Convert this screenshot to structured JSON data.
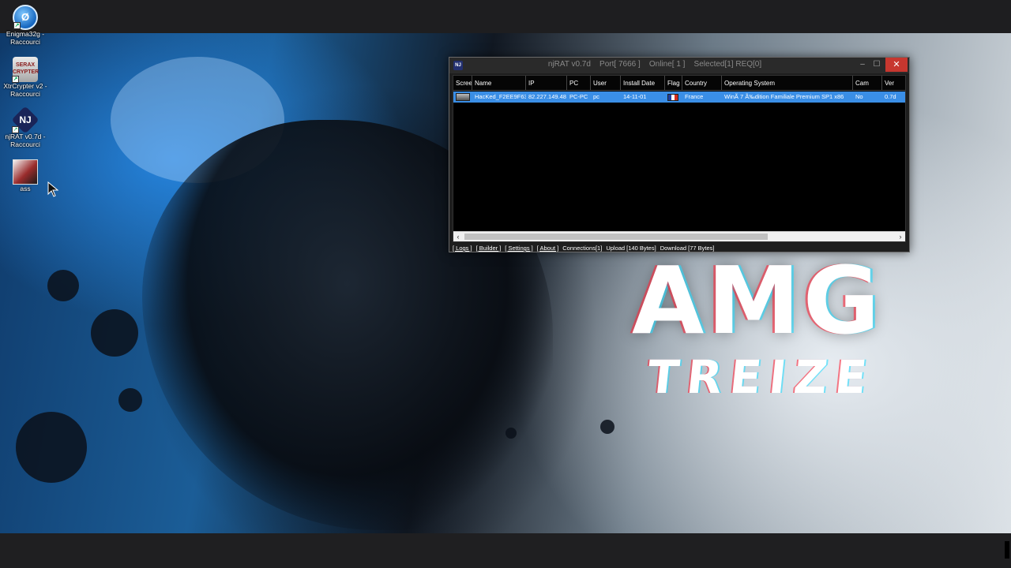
{
  "desktop": {
    "icons": [
      {
        "label": "Enigma32g - Raccourci",
        "glyph": "Ø",
        "icon": "enigma-icon"
      },
      {
        "label": "XtrCrypter v2 - Raccourci",
        "glyph": "SERAX CRYPTER",
        "icon": "serax-crypter-icon"
      },
      {
        "label": "njRAT v0.7d - Raccourci",
        "glyph": "NJ",
        "icon": "njrat-icon"
      },
      {
        "label": "ass",
        "glyph": "",
        "icon": "image-file-icon"
      }
    ]
  },
  "wallpaper": {
    "headline": "AMG",
    "subline": "TREIZE"
  },
  "window": {
    "title": "njRAT v0.7d    Port[ 7666 ]    Online[ 1 ]    Selected[1] REQ[0]",
    "app_icon_text": "NJ",
    "buttons": {
      "minimize": "–",
      "maximize": "☐",
      "close": "✕"
    },
    "columns": [
      "Scree",
      "Name",
      "IP",
      "PC",
      "User",
      "Install Date",
      "Flag",
      "Country",
      "Operating System",
      "Cam",
      "Ver"
    ],
    "rows": [
      {
        "name": "HacKed_F2EE9F63",
        "ip": "82.227.149.48",
        "pc": "PC-PC",
        "user": "pc",
        "install_date": "14-11-01",
        "country": "France",
        "os": "WinÃ 7 Ã‰dition Familiale Premium SP1 x86",
        "cam": "No",
        "ver": "0.7d",
        "flag_colors": [
          "#1f3fa0",
          "#ffffff",
          "#d52b1e"
        ]
      }
    ],
    "scroll": {
      "left": "‹",
      "right": "›"
    },
    "status": {
      "logs": "[ Logs ]",
      "builder": "[ Builder ]",
      "settings": "[ Settings ]",
      "about": "[ About ]",
      "connections": "Connections[1]",
      "upload": "Upload [140 Bytes]",
      "download": "Download [77 Bytes]"
    }
  },
  "colors": {
    "selected_row": "#3a8ee6",
    "close_button": "#c7372f"
  }
}
